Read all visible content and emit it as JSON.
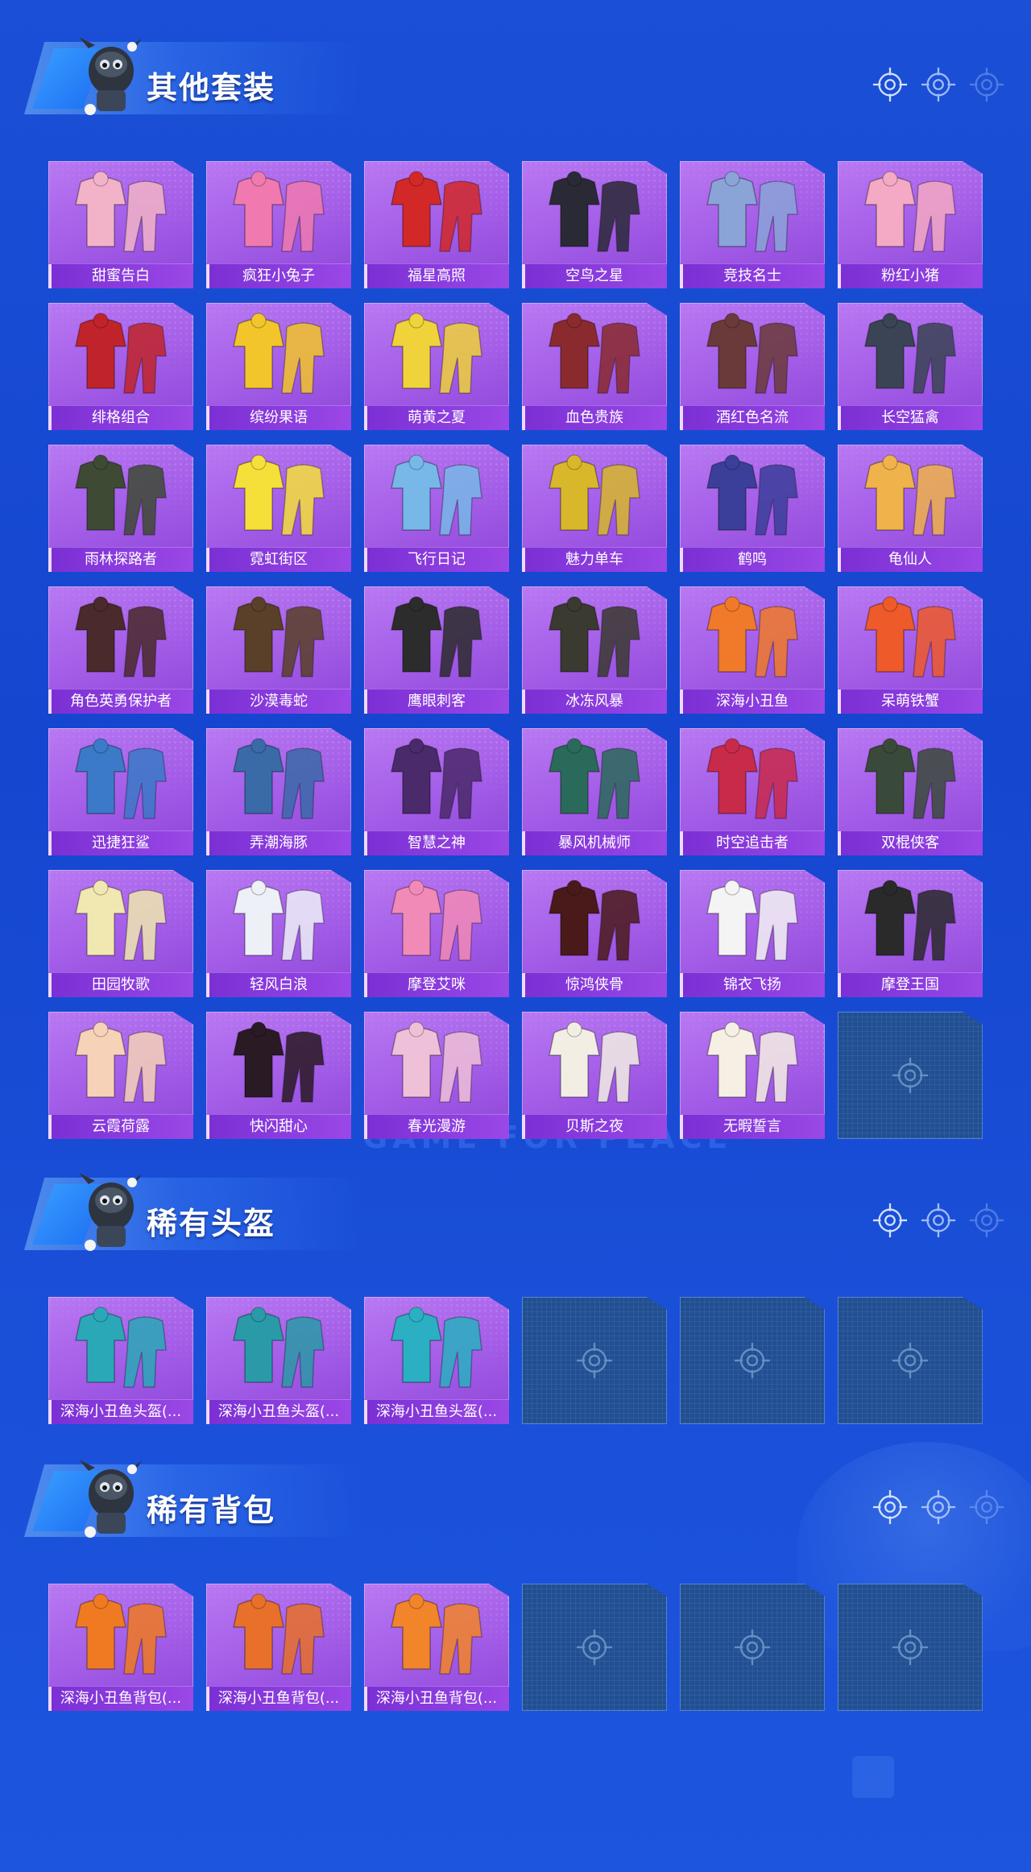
{
  "decor": {
    "watermark": "GAME FOR PEACE"
  },
  "colors": {
    "bg": "#1546cf",
    "card": "#a45ee8",
    "card_label": "#7a2fd4",
    "empty_card": "#214f91"
  },
  "sections": [
    {
      "title": "其他套装",
      "items": [
        {
          "label": "甜蜜告白",
          "hue": "#f2b3c8"
        },
        {
          "label": "疯狂小兔子",
          "hue": "#f07ab0"
        },
        {
          "label": "福星高照",
          "hue": "#d22828"
        },
        {
          "label": "空鸟之星",
          "hue": "#2a2a36"
        },
        {
          "label": "竞技名士",
          "hue": "#8aa4d8"
        },
        {
          "label": "粉红小猪",
          "hue": "#f4a9c4"
        },
        {
          "label": "绯格组合",
          "hue": "#c0242a"
        },
        {
          "label": "缤纷果语",
          "hue": "#f2c52a"
        },
        {
          "label": "萌黄之夏",
          "hue": "#f0d23a"
        },
        {
          "label": "血色贵族",
          "hue": "#8a2a2f"
        },
        {
          "label": "酒红色名流",
          "hue": "#6a3a3a"
        },
        {
          "label": "长空猛禽",
          "hue": "#3a4454"
        },
        {
          "label": "雨林探路者",
          "hue": "#3e4a34"
        },
        {
          "label": "霓虹街区",
          "hue": "#f5e03a"
        },
        {
          "label": "飞行日记",
          "hue": "#78b8e8"
        },
        {
          "label": "魅力单车",
          "hue": "#d8b82a"
        },
        {
          "label": "鹤鸣",
          "hue": "#3b3f9a"
        },
        {
          "label": "龟仙人",
          "hue": "#f0b24a"
        },
        {
          "label": "角色英勇保护者",
          "hue": "#4a2a2a"
        },
        {
          "label": "沙漠毒蛇",
          "hue": "#5a4028"
        },
        {
          "label": "鹰眼刺客",
          "hue": "#2c2c2c"
        },
        {
          "label": "冰冻风暴",
          "hue": "#3a3a30"
        },
        {
          "label": "深海小丑鱼",
          "hue": "#f07a2a"
        },
        {
          "label": "呆萌铁蟹",
          "hue": "#ee5a2a"
        },
        {
          "label": "迅捷狂鲨",
          "hue": "#3a7ac8"
        },
        {
          "label": "弄潮海豚",
          "hue": "#3a6aa8"
        },
        {
          "label": "智慧之神",
          "hue": "#4a2a6a"
        },
        {
          "label": "暴风机械师",
          "hue": "#2a6a5a"
        },
        {
          "label": "时空追击者",
          "hue": "#c82a4a"
        },
        {
          "label": "双棍侠客",
          "hue": "#3a4a3a"
        },
        {
          "label": "田园牧歌",
          "hue": "#f0e8b0"
        },
        {
          "label": "轻风白浪",
          "hue": "#eef0f8"
        },
        {
          "label": "摩登艾咪",
          "hue": "#f28ab8"
        },
        {
          "label": "惊鸿侠骨",
          "hue": "#4a1a1a"
        },
        {
          "label": "锦衣飞扬",
          "hue": "#f4f4f4"
        },
        {
          "label": "摩登王国",
          "hue": "#2a2a2a"
        },
        {
          "label": "云霞荷露",
          "hue": "#f6d2b8"
        },
        {
          "label": "快闪甜心",
          "hue": "#2a1a24"
        },
        {
          "label": "春光漫游",
          "hue": "#f0c0d8"
        },
        {
          "label": "贝斯之夜",
          "hue": "#f2eee4"
        },
        {
          "label": "无暇誓言",
          "hue": "#f6efe4"
        }
      ],
      "empty_slots": 1
    },
    {
      "title": "稀有头盔",
      "items": [
        {
          "label": "深海小丑鱼头盔(...",
          "hue": "#2aa8b8"
        },
        {
          "label": "深海小丑鱼头盔(...",
          "hue": "#2a9aa8"
        },
        {
          "label": "深海小丑鱼头盔(...",
          "hue": "#2ab0c2"
        }
      ],
      "empty_slots": 3
    },
    {
      "title": "稀有背包",
      "items": [
        {
          "label": "深海小丑鱼背包(...",
          "hue": "#f07a22"
        },
        {
          "label": "深海小丑鱼背包(...",
          "hue": "#e8702a"
        },
        {
          "label": "深海小丑鱼背包(...",
          "hue": "#f2842a"
        }
      ],
      "empty_slots": 3
    }
  ]
}
